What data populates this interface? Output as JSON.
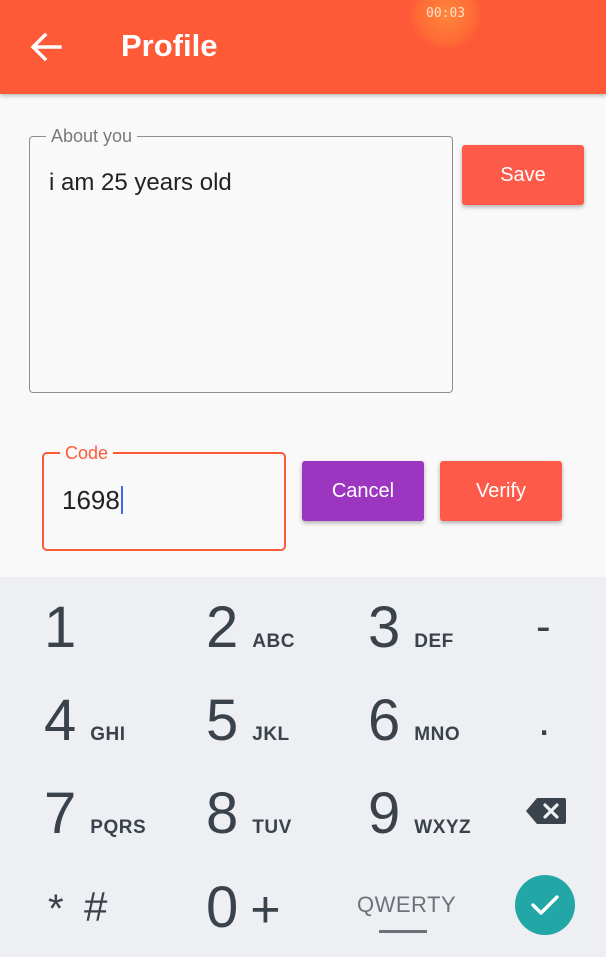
{
  "appbar": {
    "title": "Profile",
    "recording_time": "00:03",
    "back_icon": "arrow-left-icon"
  },
  "about": {
    "label": "About you",
    "value": "i am 25 years old"
  },
  "save_label": "Save",
  "code": {
    "label": "Code",
    "value": "1698"
  },
  "cancel_label": "Cancel",
  "verify_label": "Verify",
  "keyboard": {
    "keys": [
      {
        "digit": "1",
        "letters": ""
      },
      {
        "digit": "2",
        "letters": "ABC"
      },
      {
        "digit": "3",
        "letters": "DEF"
      },
      {
        "digit": "4",
        "letters": "GHI"
      },
      {
        "digit": "5",
        "letters": "JKL"
      },
      {
        "digit": "6",
        "letters": "MNO"
      },
      {
        "digit": "7",
        "letters": "PQRS"
      },
      {
        "digit": "8",
        "letters": "TUV"
      },
      {
        "digit": "9",
        "letters": "WXYZ"
      },
      {
        "digit": "0",
        "letters": "+"
      }
    ],
    "minus": "-",
    "dot": ".",
    "star": "*",
    "hash": "#",
    "qwerty": "QWERTY",
    "backspace_icon": "backspace-icon",
    "enter_icon": "checkmark-icon"
  },
  "colors": {
    "accent": "#fe5a38",
    "button": "#fe5a4a",
    "cancel": "#9c35bf",
    "enter": "#22a6a6"
  }
}
